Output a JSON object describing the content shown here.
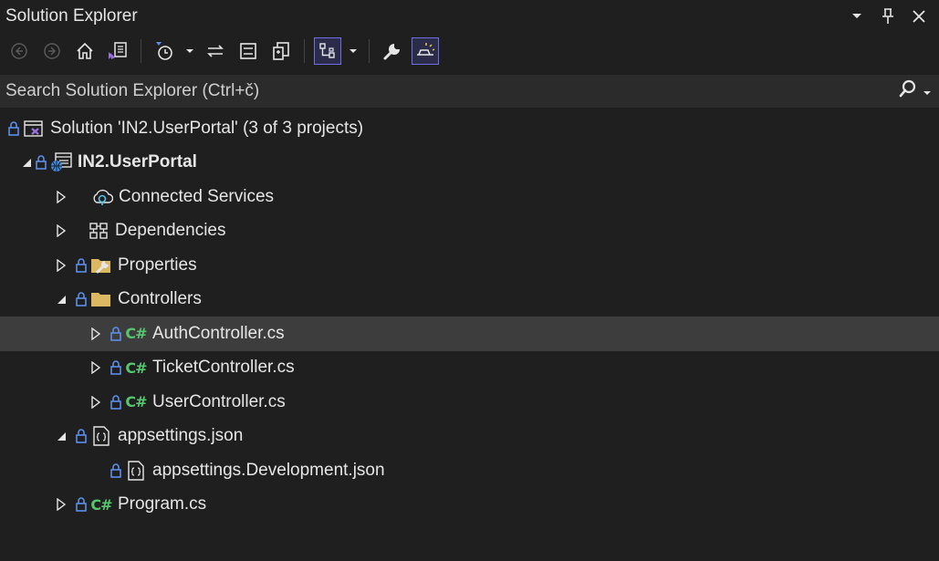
{
  "window": {
    "title": "Solution Explorer",
    "controls": [
      "dropdown-icon",
      "pin-icon",
      "close-icon"
    ]
  },
  "toolbar": {
    "buttons": [
      "back-icon",
      "forward-icon",
      "home-icon",
      "switch-views-icon",
      "pending-changes-filter-icon",
      "sync-with-active-document-icon",
      "collapse-all-icon",
      "show-all-files-icon",
      "sync-view-icon",
      "properties-icon",
      "preview-selected-items-icon"
    ]
  },
  "search": {
    "placeholder": "Search Solution Explorer (Ctrl+č)"
  },
  "colors": {
    "background": "#1f1f1f",
    "selection": "#3d3d3d",
    "search_bg": "#2b2b2b",
    "csharp": "#57c66f",
    "lock": "#5c8fe8",
    "folder": "#dcb862"
  },
  "tree": {
    "solution": {
      "label": "Solution 'IN2.UserPortal' (3 of 3 projects)"
    },
    "project": {
      "label": "IN2.UserPortal"
    },
    "connected_services": {
      "label": "Connected Services"
    },
    "dependencies": {
      "label": "Dependencies"
    },
    "properties": {
      "label": "Properties"
    },
    "controllers": {
      "label": "Controllers"
    },
    "auth_controller": {
      "label": "AuthController.cs",
      "icon_text": "C#"
    },
    "ticket_controller": {
      "label": "TicketController.cs",
      "icon_text": "C#"
    },
    "user_controller": {
      "label": "UserController.cs",
      "icon_text": "C#"
    },
    "appsettings": {
      "label": "appsettings.json"
    },
    "appsettings_dev": {
      "label": "appsettings.Development.json"
    },
    "program": {
      "label": "Program.cs",
      "icon_text": "C#"
    }
  }
}
